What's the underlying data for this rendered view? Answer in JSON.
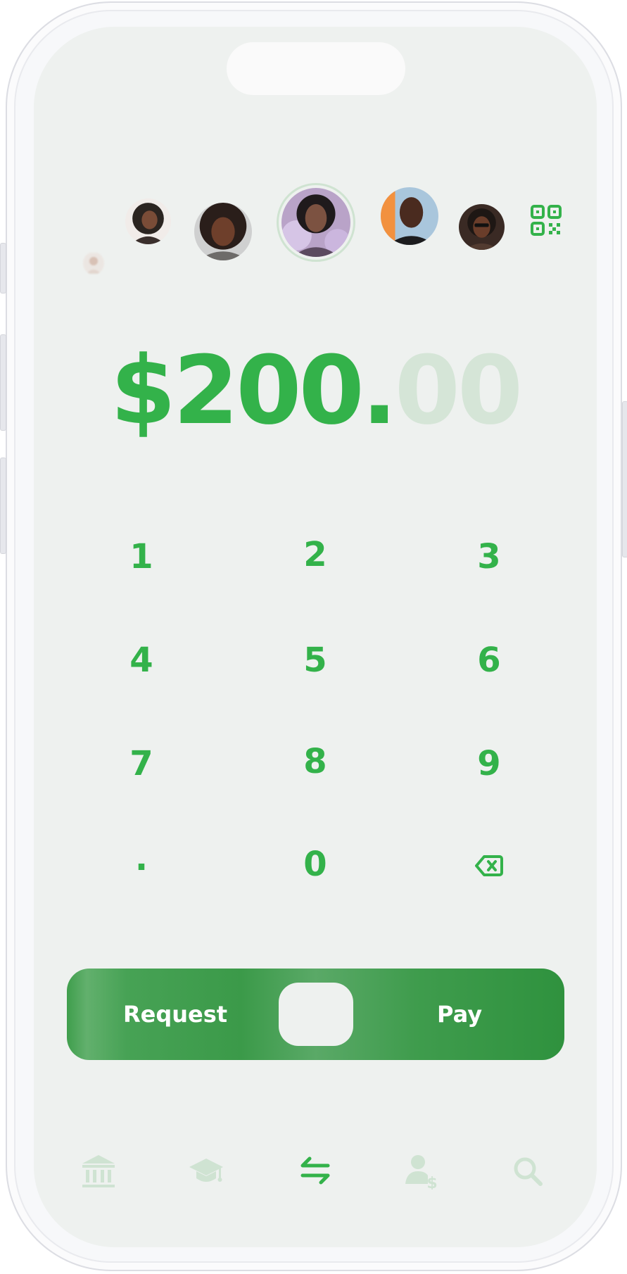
{
  "contacts": [
    {
      "id": "contact-1",
      "state": "faded"
    },
    {
      "id": "contact-2",
      "state": "small"
    },
    {
      "id": "contact-3",
      "state": "normal"
    },
    {
      "id": "contact-4",
      "state": "selected"
    },
    {
      "id": "contact-5",
      "state": "normal"
    },
    {
      "id": "contact-6",
      "state": "normal"
    }
  ],
  "amount": {
    "whole": "$200.",
    "cents": "00"
  },
  "keypad": {
    "keys": [
      "1",
      "2",
      "3",
      "4",
      "5",
      "6",
      "7",
      "8",
      "9",
      ".",
      "0"
    ],
    "backspace_icon": "backspace-icon"
  },
  "actions": {
    "request_label": "Request",
    "pay_label": "Pay"
  },
  "tabbar": {
    "items": [
      "bank-icon",
      "graduation-cap-icon",
      "transfer-icon",
      "user-dollar-icon",
      "search-icon"
    ],
    "active": "transfer-icon"
  },
  "colors": {
    "accent": "#33b24a",
    "accent_faded": "#d5e5d7",
    "action_bar": "#3b9a49",
    "inactive_icon": "#cfe3d2",
    "background": "#eef1ef"
  }
}
